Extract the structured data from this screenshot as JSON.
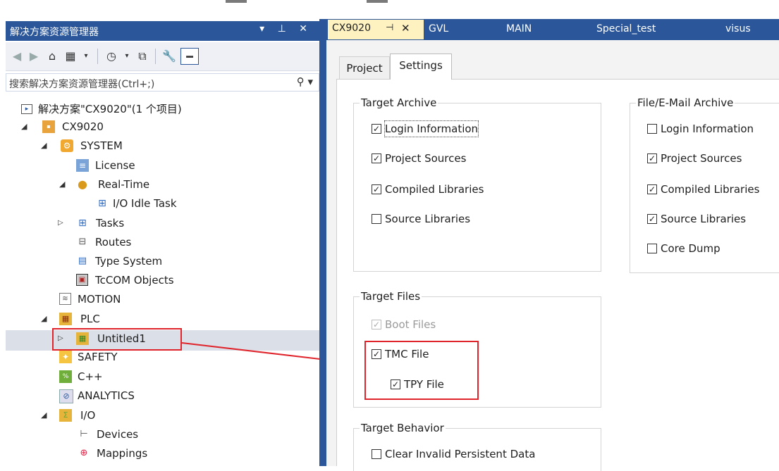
{
  "solution_explorer": {
    "title": "解决方案资源管理器",
    "title_buttons": "▾ ⊥ ✕",
    "search_placeholder": "搜索解决方案资源管理器(Ctrl+;)",
    "search_icon": "magnifier-icon",
    "tree": [
      {
        "label": "解决方案\"CX9020\"(1 个项目)",
        "icon": "solution-icon"
      },
      {
        "label": "CX9020",
        "icon": "project-icon"
      },
      {
        "label": "SYSTEM",
        "icon": "system-icon"
      },
      {
        "label": "License",
        "icon": "license-icon"
      },
      {
        "label": "Real-Time",
        "icon": "realtime-icon"
      },
      {
        "label": "I/O Idle Task",
        "icon": "task-icon"
      },
      {
        "label": "Tasks",
        "icon": "tasks-icon"
      },
      {
        "label": "Routes",
        "icon": "routes-icon"
      },
      {
        "label": "Type System",
        "icon": "type-system-icon"
      },
      {
        "label": "TcCOM Objects",
        "icon": "tccom-icon"
      },
      {
        "label": "MOTION",
        "icon": "motion-icon"
      },
      {
        "label": "PLC",
        "icon": "plc-icon"
      },
      {
        "label": "Untitled1",
        "icon": "plc-project-icon"
      },
      {
        "label": "SAFETY",
        "icon": "safety-icon"
      },
      {
        "label": "C++",
        "icon": "cpp-icon"
      },
      {
        "label": "ANALYTICS",
        "icon": "analytics-icon"
      },
      {
        "label": "I/O",
        "icon": "io-icon"
      },
      {
        "label": "Devices",
        "icon": "devices-icon"
      },
      {
        "label": "Mappings",
        "icon": "mappings-icon"
      }
    ]
  },
  "editor": {
    "tabs": [
      {
        "label": "CX9020",
        "active": true
      },
      {
        "label": "GVL"
      },
      {
        "label": "MAIN"
      },
      {
        "label": "Special_test"
      },
      {
        "label": "visus"
      }
    ],
    "pin_glyph": "⊣",
    "close_glyph": "✕",
    "subtabs": [
      "Project",
      "Settings"
    ],
    "active_subtab": "Settings",
    "groups": {
      "target_archive": {
        "title": "Target Archive",
        "items": [
          {
            "label": "Login Information",
            "checked": true,
            "focused": true
          },
          {
            "label": "Project Sources",
            "checked": true
          },
          {
            "label": "Compiled Libraries",
            "checked": true
          },
          {
            "label": "Source Libraries",
            "checked": false
          }
        ]
      },
      "file_archive": {
        "title": "File/E-Mail Archive",
        "items": [
          {
            "label": "Login Information",
            "checked": false
          },
          {
            "label": "Project Sources",
            "checked": true
          },
          {
            "label": "Compiled Libraries",
            "checked": true
          },
          {
            "label": "Source Libraries",
            "checked": true
          },
          {
            "label": "Core Dump",
            "checked": false
          }
        ]
      },
      "target_files": {
        "title": "Target Files",
        "items": [
          {
            "label": "Boot Files",
            "checked": true,
            "disabled": true
          },
          {
            "label": "TMC File",
            "checked": true
          },
          {
            "label": "TPY File",
            "checked": true
          }
        ]
      },
      "target_behavior": {
        "title": "Target Behavior",
        "items": [
          {
            "label": "Clear Invalid Persistent Data",
            "checked": false
          }
        ]
      }
    }
  },
  "colors": {
    "accent": "#2b579a",
    "active_tab": "#fef2c0",
    "highlight": "#e0242b"
  }
}
